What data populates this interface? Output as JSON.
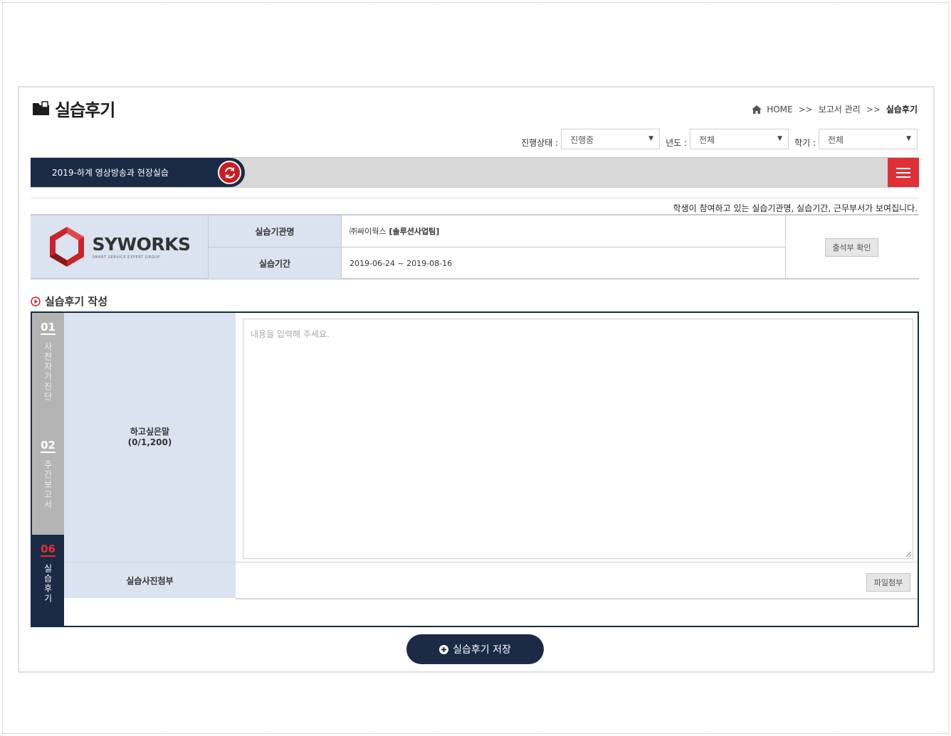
{
  "header": {
    "title": "실습후기",
    "breadcrumb": [
      "HOME",
      "보고서 관리",
      "실습후기"
    ],
    "breadcrumb_sep": ">>"
  },
  "filters": {
    "status_label": "진행상태 :",
    "status_value": "진행중",
    "year_label": "년도 :",
    "year_value": "전체",
    "semester_label": "학기 :",
    "semester_value": "전체"
  },
  "course": {
    "name": "2019-하계 영상방송과 현장실습"
  },
  "notice": "학생이 참여하고 있는 실습기관명, 실습기간, 근무부서가 보여집니다.",
  "company": {
    "logo_name": "SYWORKS",
    "logo_tagline": "SMART SERVICE EXPERT GROUP",
    "name_label": "실습기관명",
    "name_value": "㈜싸이웍스",
    "department": "[솔루션사업팀]",
    "period_label": "실습기간",
    "period_value": "2019-06-24 ~ 2019-08-16",
    "attendance_button": "출석부 확인"
  },
  "section_title": "실습후기 작성",
  "steps": [
    {
      "num": "01",
      "text": "사전자가진단"
    },
    {
      "num": "02",
      "text": "주간보고서"
    },
    {
      "num": "06",
      "text": "실습후기"
    }
  ],
  "form": {
    "comment_label": "하고싶은말",
    "comment_count": "(0/1,200)",
    "comment_placeholder": "내용을 입력해 주세요.",
    "photo_label": "실습사진첨부",
    "file_button": "파일첨부"
  },
  "save_button": "실습후기 저장",
  "colors": {
    "navy": "#1b2a45",
    "red": "#e03037",
    "label_bg": "#dae3ef",
    "step_gray": "#b4b4b4"
  }
}
